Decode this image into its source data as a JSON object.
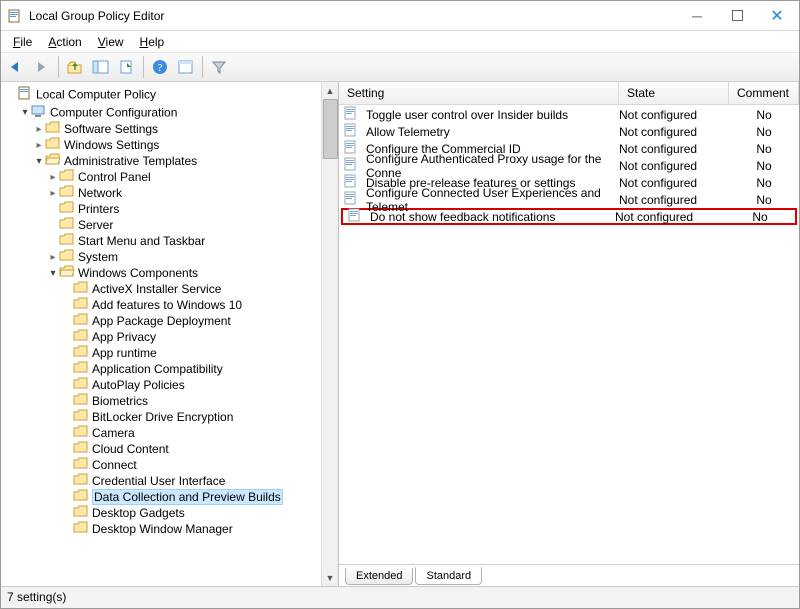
{
  "window": {
    "title": "Local Group Policy Editor"
  },
  "menu": {
    "file": "File",
    "action": "Action",
    "view": "View",
    "help": "Help"
  },
  "tree": {
    "root": "Local Computer Policy",
    "computer_config": "Computer Configuration",
    "software_settings": "Software Settings",
    "windows_settings": "Windows Settings",
    "admin_templates": "Administrative Templates",
    "control_panel": "Control Panel",
    "network": "Network",
    "printers": "Printers",
    "server": "Server",
    "start_menu": "Start Menu and Taskbar",
    "system": "System",
    "windows_components": "Windows Components",
    "wc": {
      "activex": "ActiveX Installer Service",
      "addfeatures": "Add features to Windows 10",
      "apppackage": "App Package Deployment",
      "appprivacy": "App Privacy",
      "appruntime": "App runtime",
      "appcompat": "Application Compatibility",
      "autoplay": "AutoPlay Policies",
      "biometrics": "Biometrics",
      "bitlocker": "BitLocker Drive Encryption",
      "camera": "Camera",
      "cloud": "Cloud Content",
      "connect": "Connect",
      "credui": "Credential User Interface",
      "datacoll": "Data Collection and Preview Builds",
      "gadgets": "Desktop Gadgets",
      "dwm": "Desktop Window Manager"
    }
  },
  "list": {
    "columns": {
      "setting": "Setting",
      "state": "State",
      "comment": "Comment"
    },
    "rows": [
      {
        "setting": "Toggle user control over Insider builds",
        "state": "Not configured",
        "comment": "No"
      },
      {
        "setting": "Allow Telemetry",
        "state": "Not configured",
        "comment": "No"
      },
      {
        "setting": "Configure the Commercial ID",
        "state": "Not configured",
        "comment": "No"
      },
      {
        "setting": "Configure Authenticated Proxy usage for the Conne",
        "state": "Not configured",
        "comment": "No"
      },
      {
        "setting": "Disable pre-release features or settings",
        "state": "Not configured",
        "comment": "No"
      },
      {
        "setting": "Configure Connected User Experiences and Telemet",
        "state": "Not configured",
        "comment": "No"
      },
      {
        "setting": "Do not show feedback notifications",
        "state": "Not configured",
        "comment": "No",
        "highlight": true
      }
    ]
  },
  "tabs": {
    "extended": "Extended",
    "standard": "Standard"
  },
  "statusbar": "7 setting(s)"
}
